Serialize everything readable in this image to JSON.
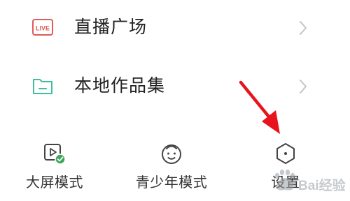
{
  "menu": {
    "items": [
      {
        "label": "直播广场",
        "icon": "live-icon",
        "icon_text": "LIVE"
      },
      {
        "label": "本地作品集",
        "icon": "folder-icon"
      }
    ]
  },
  "shortcuts": [
    {
      "label": "大屏模式",
      "icon": "big-screen-play-icon"
    },
    {
      "label": "青少年模式",
      "icon": "teen-face-icon"
    },
    {
      "label": "设置",
      "icon": "settings-hexagon-icon"
    }
  ],
  "annotation": {
    "color": "#e8141d",
    "icon": "arrow-icon"
  },
  "watermark": {
    "text": "Bai经验"
  },
  "colors": {
    "live_red": "#e05a5a",
    "folder_green": "#3fbf9a",
    "check_green": "#3aa75a",
    "chevron_gray": "#c4c4c4",
    "icon_gray": "#444444",
    "arrow_red": "#e8141d"
  }
}
